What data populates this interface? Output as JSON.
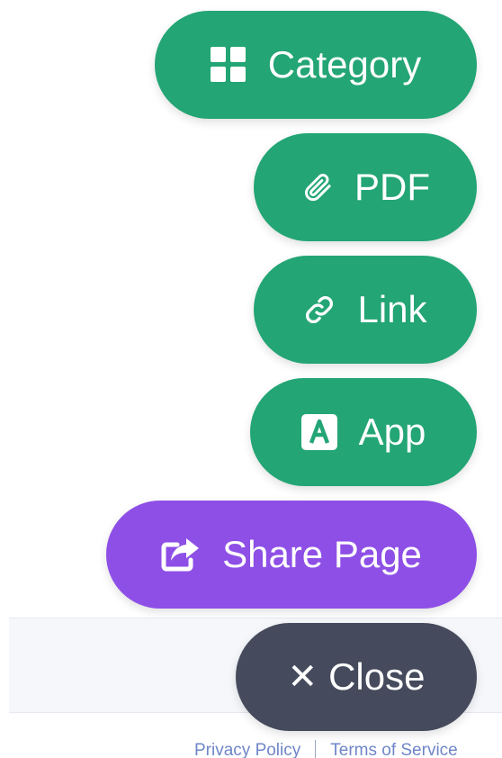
{
  "menu": {
    "category_label": "Category",
    "pdf_label": "PDF",
    "link_label": "Link",
    "app_label": "App",
    "share_label": "Share Page",
    "close_label": "Close",
    "close_glyph": "✕"
  },
  "footer": {
    "privacy_label": "Privacy Policy",
    "terms_label": "Terms of Service"
  },
  "icons": {
    "category": "grid-icon",
    "pdf": "paperclip-icon",
    "link": "link-icon",
    "app": "app-letter-icon",
    "share": "share-icon",
    "close": "close-icon"
  },
  "colors": {
    "green": "#23a575",
    "purple": "#8e4fe6",
    "dark": "#454a5c",
    "footer_link": "#6f86c8"
  }
}
